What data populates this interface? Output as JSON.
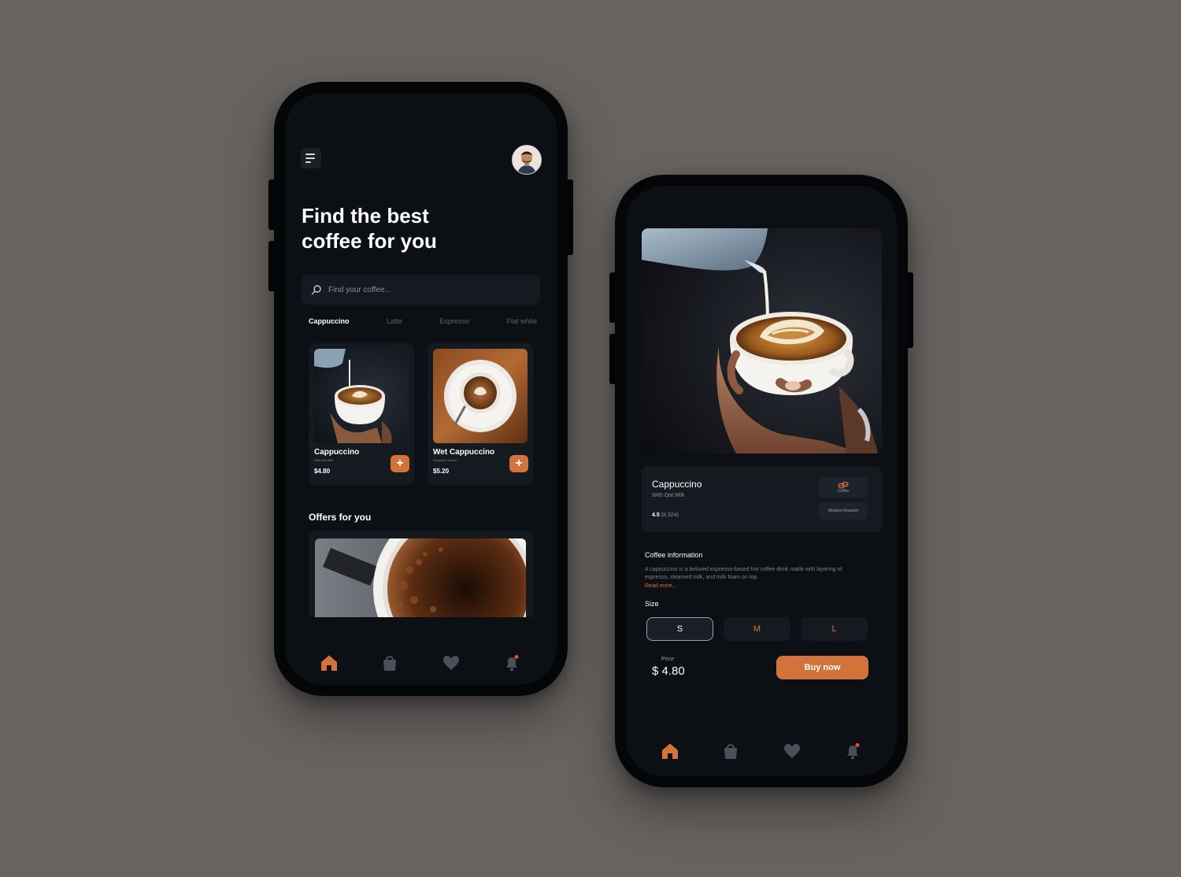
{
  "colors": {
    "accent": "#D1733A",
    "screen_bg": "#0C0F14",
    "card_bg": "#151A21",
    "page_bg": "#676361"
  },
  "home": {
    "headline_line1": "Find the best",
    "headline_line2": "coffee for you",
    "search": {
      "placeholder": "Find your coffee..."
    },
    "categories": [
      "Cappuccino",
      "Latte",
      "Espresso",
      "Flat white"
    ],
    "active_category": "Cappuccino",
    "products": [
      {
        "name": "Cappuccino",
        "subtitle": "With Oat Milk",
        "price": "$4.80"
      },
      {
        "name": "Wet Cappuccino",
        "subtitle": "Creamier Texture",
        "price": "$5.20"
      }
    ],
    "offers_title": "Offers for you"
  },
  "detail": {
    "name": "Cappuccino",
    "subtitle": "With Oat Milk",
    "rating": "4.5",
    "rating_count": "(8.324)",
    "tag_coffee": "Coffee",
    "tag_roast": "Medium Roasted",
    "info_title": "Coffee information",
    "description": "A cappuccino is a beloved espresso-based hot coffee drink made with layering of espresso, steamed milk, and milk foam on top.",
    "read_more": "Read more...",
    "size_title": "Size",
    "sizes": [
      "S",
      "M",
      "L"
    ],
    "selected_size": "S",
    "price_label": "Price",
    "price": "$ 4.80",
    "buy_label": "Buy now"
  },
  "nav_icons": [
    "home-icon",
    "bag-icon",
    "heart-icon",
    "bell-icon"
  ]
}
